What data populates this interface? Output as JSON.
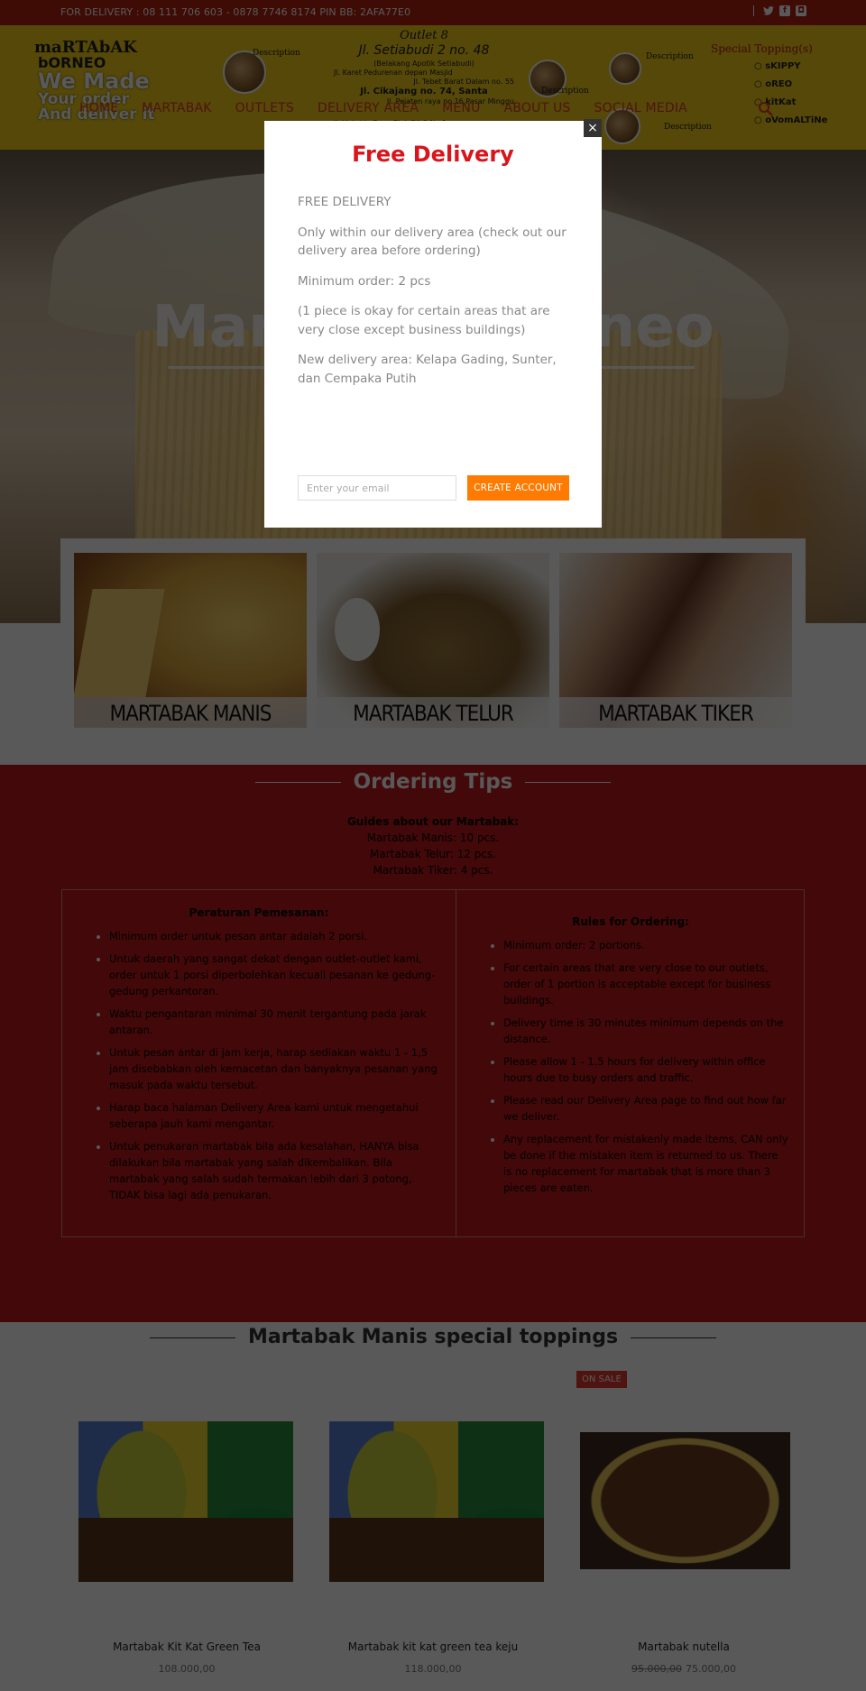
{
  "topbar": {
    "contact": "FOR DELIVERY : 08 111 706 603 - 0878 7746 8174 PIN BB: 2AFA77E0",
    "social_icons": [
      "twitter-icon",
      "facebook-icon",
      "instagram-icon"
    ]
  },
  "banner": {
    "brand_lines": [
      "maRTAbAK",
      "bORNEO",
      "We Made",
      "Your order",
      "And deliver it"
    ],
    "vertical_text": "BORNEO",
    "outlet_heading": "Outlet 8",
    "main_address": "Jl. Setiabudi 2 no. 48",
    "main_address_note": "(Belakang Apotik Setiabudi)",
    "addresses": [
      "Jl. Karet Pedurenan depan Masjid",
      "Jl. Tebet Barat Dalam no. 55",
      "Jl. Cikajang no. 74, Santa",
      "Jl. Pejaten raya no.16,Pasar Minggu",
      "Jl. Hybrida Raya Blok RA 2 No 1"
    ],
    "special_topping_title": "Special Topping(s)",
    "toppings": [
      "sKIPPY",
      "oREO",
      "kitKat",
      "oVomALTiNe"
    ],
    "description_labels": [
      "Description",
      "Description",
      "Description",
      "Description"
    ]
  },
  "nav": {
    "items": [
      "HOME",
      "MARTABAK",
      "OUTLETS",
      "DELIVERY AREA",
      "MENU",
      "ABOUT US",
      "SOCIAL MEDIA"
    ],
    "search_icon": "search-icon"
  },
  "hero": {
    "title": "Martabak Borneo"
  },
  "categories": [
    {
      "label": "MARTABAK MANIS"
    },
    {
      "label": "MARTABAK TELUR"
    },
    {
      "label": "MARTABAK TIKER"
    }
  ],
  "ordering_tips": {
    "title": "Ordering Tips",
    "guides_heading": "Guides about our Martabak:",
    "guides": [
      "Martabak Manis: 10 pcs.",
      "Martabak Telur: 12 pcs.",
      "Martabak Tiker: 4 pcs."
    ],
    "left": {
      "heading": "Peraturan Pemesanan:",
      "items": [
        "Minimum order untuk pesan antar adalah 2 porsi.",
        "Untuk daerah yang sangat dekat dengan outlet-outlet kami, order untuk 1 porsi diperbolehkan kecuali pesanan ke gedung-gedung perkantoran.",
        "Waktu pengantaran minimal 30 menit tergantung pada jarak antaran.",
        "Untuk pesan antar di jam kerja, harap sediakan waktu 1 - 1,5 jam disebabkan oleh kemacetan dan banyaknya pesanan yang masuk pada waktu tersebut.",
        "Harap baca halaman Delivery Area kami untuk mengetahui seberapa jauh kami mengantar.",
        "Untuk penukaran martabak bila ada kesalahan, HANYA bisa dilakukan bila martabak yang salah dikembalikan. Bila martabak yang salah sudah termakan lebih dari 3 potong, TIDAK bisa lagi ada penukaran."
      ]
    },
    "right": {
      "heading": "Rules for Ordering:",
      "items": [
        "Minimum order: 2 portions.",
        "For certain areas that are very close to our outlets, order of 1 portion is acceptable except for business buildings.",
        "Delivery time is 30 minutes minimum depends on the distance.",
        "Please allow 1 - 1.5 hours for delivery within office hours due to busy orders and traffic.",
        "Please read our Delivery Area page to find out how far we deliver.",
        "Any replacement for mistakenly made items, CAN only be done if the mistaken item is returned to us. There is no replacement for martabak that is more than 3 pieces are eaten."
      ]
    }
  },
  "toppings_section": {
    "title": "Martabak Manis special toppings",
    "sale_badge": "ON SALE",
    "products": [
      {
        "name": "Martabak Kit Kat Green Tea",
        "price": "108.000,00"
      },
      {
        "name": "Martabak kit kat green tea keju",
        "price": "118.000,00"
      },
      {
        "name": "Martabak nutella",
        "old_price": "95.000,00",
        "price": "75.000,00"
      }
    ]
  },
  "modal": {
    "title": "Free Delivery",
    "paragraphs": [
      "FREE DELIVERY",
      "Only within our delivery area (check out our delivery area before ordering)",
      "Minimum order: 2 pcs",
      "(1 piece is okay for certain areas that are very close except business buildings)",
      "New delivery area: Kelapa Gading, Sunter, dan Cempaka Putih"
    ],
    "email_placeholder": "Enter your email",
    "email_value": "",
    "cta_label": "CREATE ACCOUNT",
    "close_label": "×"
  },
  "colors": {
    "brand_red": "#c0181c",
    "topbar_red": "#b2200f",
    "banner_yellow": "#f2cf18",
    "cta_orange": "#ff7a00",
    "modal_title_red": "#d9151c",
    "sale_red": "#e23b2f"
  }
}
